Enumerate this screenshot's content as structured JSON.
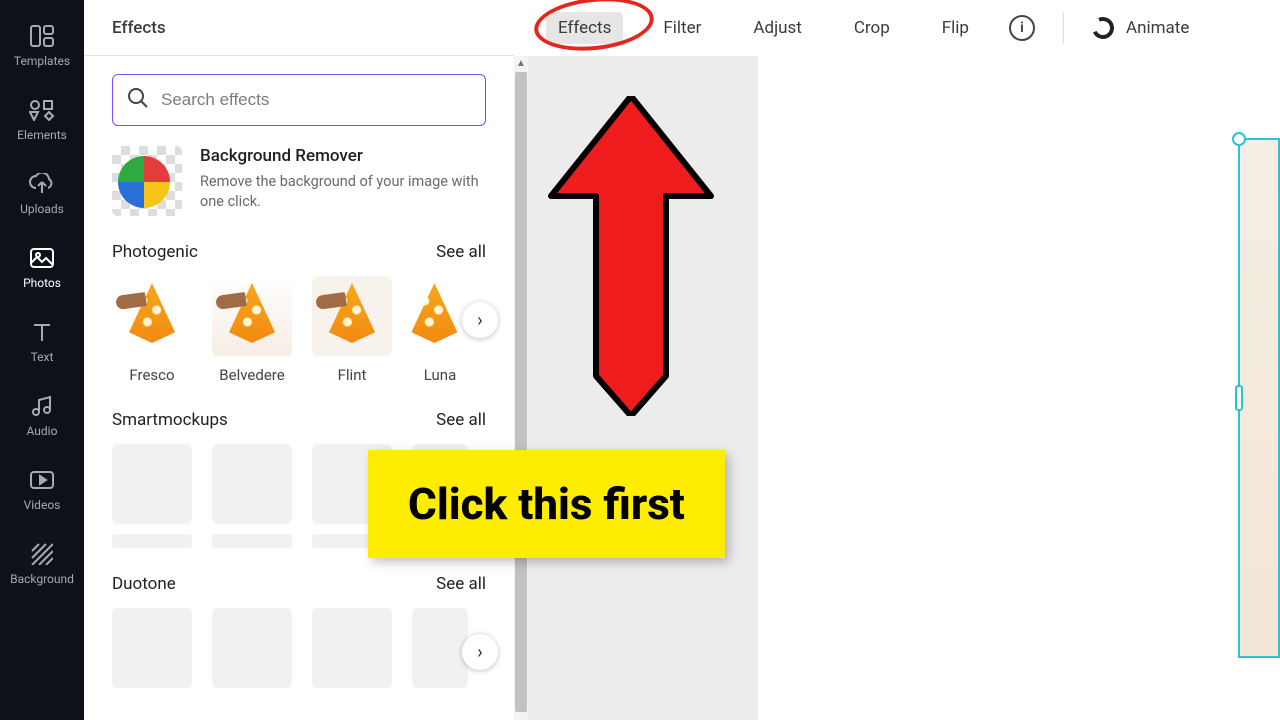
{
  "sidebar": {
    "items": [
      {
        "label": "Templates"
      },
      {
        "label": "Elements"
      },
      {
        "label": "Uploads"
      },
      {
        "label": "Photos"
      },
      {
        "label": "Text"
      },
      {
        "label": "Audio"
      },
      {
        "label": "Videos"
      },
      {
        "label": "Background"
      }
    ],
    "active_index": 3
  },
  "panel": {
    "title": "Effects",
    "search_placeholder": "Search effects",
    "bg_remover": {
      "title": "Background Remover",
      "subtitle": "Remove the background of your image with one click."
    },
    "sections": [
      {
        "title": "Photogenic",
        "see_all": "See all",
        "items": [
          {
            "label": "Fresco"
          },
          {
            "label": "Belvedere"
          },
          {
            "label": "Flint"
          },
          {
            "label": "Luna"
          }
        ]
      },
      {
        "title": "Smartmockups",
        "see_all": "See all"
      },
      {
        "title": "Duotone",
        "see_all": "See all"
      }
    ]
  },
  "topbar": {
    "items": [
      {
        "label": "Effects"
      },
      {
        "label": "Filter"
      },
      {
        "label": "Adjust"
      },
      {
        "label": "Crop"
      },
      {
        "label": "Flip"
      }
    ],
    "animate_label": "Animate",
    "active_index": 0
  },
  "annotations": {
    "callout": "Click this first"
  }
}
